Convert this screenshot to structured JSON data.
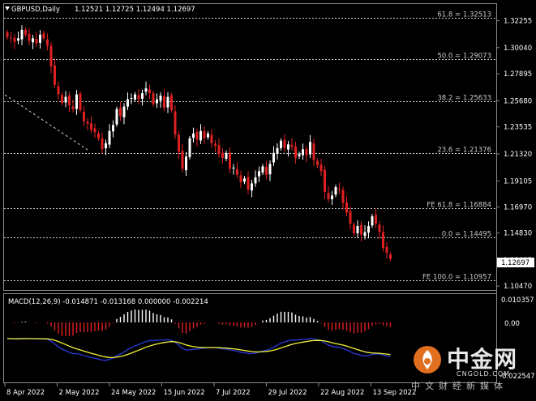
{
  "header": {
    "symbol": "GBPUSD,Daily",
    "ohlc": "1.12521 1.12725 1.12494 1.12697"
  },
  "colors": {
    "background": "#000000",
    "bull_candle": "#ffffff",
    "bear_candle": "#e02020",
    "macd_main": "#2a3ad8",
    "macd_signal": "#f2f23a",
    "hist_pos": "#ffffff",
    "hist_neg": "#e02020",
    "fib_line": "#cfcfcf",
    "price_marker_bg": "#ffffff"
  },
  "price_axis": {
    "ticks": [
      "1.32255",
      "1.30040",
      "1.27895",
      "1.25680",
      "1.23535",
      "1.21320",
      "1.19105",
      "1.16970",
      "1.14830",
      "1.12615",
      "1.10470"
    ],
    "current_price": "1.12697"
  },
  "fib_levels": [
    {
      "label": "61.8 = 1.32513",
      "price": 1.32513
    },
    {
      "label": "50.0 = 1.29073",
      "price": 1.29073
    },
    {
      "label": "38.2 = 1.25633",
      "price": 1.25633
    },
    {
      "label": "23.6 = 1.21376",
      "price": 1.21376
    },
    {
      "label": "FE 61.8 = 1.16884",
      "price": 1.16884
    },
    {
      "label": "0.0 = 1.14495",
      "price": 1.14495
    },
    {
      "label": "FE 100.0 = 1.10957",
      "price": 1.10957
    }
  ],
  "macd": {
    "title": "MACD(12,26,9) -0.014871 -0.013168 0.000000 -0.002214",
    "axis_ticks": [
      "0.010357",
      "0.00",
      "-0.022547"
    ]
  },
  "time_axis": {
    "labels": [
      "8 Apr 2022",
      "2 May 2022",
      "24 May 2022",
      "15 Jun 2022",
      "7 Jul 2022",
      "29 Jul 2022",
      "22 Aug 2022",
      "13 Sep 2022"
    ]
  },
  "watermark": {
    "title": "中金网",
    "domain": "CNGOLD.COM",
    "tagline": "中文财经新媒体"
  },
  "chart_data": {
    "type": "candlestick",
    "symbol": "GBPUSD",
    "timeframe": "Daily",
    "ylim": [
      1.1015,
      1.3262
    ],
    "closes": [
      1.309,
      1.308,
      1.305,
      1.308,
      1.315,
      1.311,
      1.306,
      1.308,
      1.304,
      1.311,
      1.308,
      1.302,
      1.285,
      1.27,
      1.262,
      1.255,
      1.26,
      1.253,
      1.25,
      1.262,
      1.249,
      1.24,
      1.238,
      1.233,
      1.231,
      1.226,
      1.217,
      1.222,
      1.232,
      1.237,
      1.25,
      1.244,
      1.252,
      1.258,
      1.259,
      1.262,
      1.258,
      1.263,
      1.267,
      1.263,
      1.254,
      1.258,
      1.261,
      1.251,
      1.26,
      1.249,
      1.229,
      1.215,
      1.201,
      1.211,
      1.226,
      1.23,
      1.225,
      1.232,
      1.226,
      1.23,
      1.222,
      1.22,
      1.213,
      1.21,
      1.214,
      1.201,
      1.202,
      1.196,
      1.19,
      1.193,
      1.184,
      1.189,
      1.194,
      1.199,
      1.203,
      1.196,
      1.205,
      1.214,
      1.218,
      1.224,
      1.218,
      1.221,
      1.219,
      1.21,
      1.213,
      1.217,
      1.212,
      1.223,
      1.208,
      1.204,
      1.199,
      1.182,
      1.176,
      1.179,
      1.186,
      1.184,
      1.173,
      1.165,
      1.156,
      1.148,
      1.154,
      1.147,
      1.149,
      1.154,
      1.162,
      1.156,
      1.149,
      1.136,
      1.132,
      1.127
    ]
  }
}
